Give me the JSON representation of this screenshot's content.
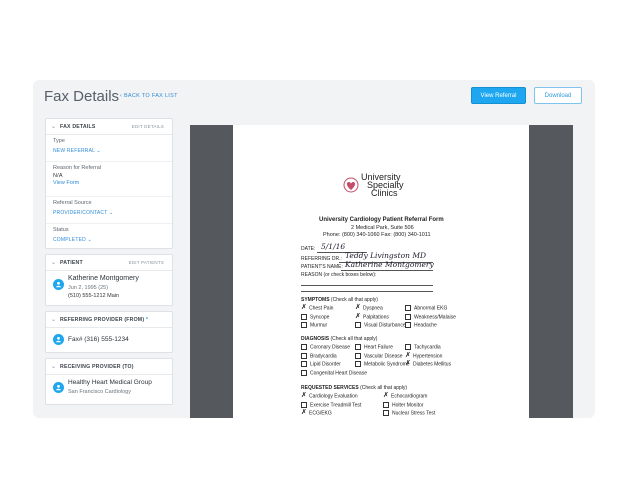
{
  "header": {
    "title": "Fax Details",
    "back_link": "‹ Back to fax list",
    "view_referral": "View Referral",
    "download": "Download"
  },
  "fax_details": {
    "heading": "FAX DETAILS",
    "action": "EDIT DETAILS",
    "type_label": "Type",
    "type_value": "NEW REFERRAL ⌄",
    "reason_label": "Reason for Referral",
    "reason_value": "N/A",
    "reason_link": "View Form",
    "source_label": "Referral Source",
    "source_value": "PROVIDER/CONTACT ⌄",
    "status_label": "Status",
    "status_value": "COMPLETED ⌄"
  },
  "patient": {
    "heading": "PATIENT",
    "action": "EDIT PATIENTS",
    "name": "Katherine Montgomery",
    "dob": "Jun 2, 1995 (25)",
    "phone": "(510) 555-1212 Main"
  },
  "referring_provider": {
    "heading": "REFERRING PROVIDER (FROM)",
    "required": "*",
    "fax": "Fax# (316) 555-1234"
  },
  "receiving_provider": {
    "heading": "RECEIVING PROVIDER (TO)",
    "name": "Healthy Heart Medical Group",
    "location": "San Francisco Cardiology"
  },
  "document": {
    "logo_line1": "University",
    "logo_line2": "Specialty",
    "logo_line3": "Clinics",
    "form_title": "University Cardiology Patient Referral Form",
    "address": "2 Medical Park, Suite 506",
    "contact": "Phone: (800) 340-1060 Fax: (800) 340-1011",
    "date_label": "DATE:",
    "date_value": "5/1/16",
    "referring_label": "REFERRING DR.:",
    "referring_value": "Teddy Livingston MD",
    "patient_label": "PATIENT'S NAME:",
    "patient_value": "Katherine Montgomery",
    "reason_label": "REASON (or check boxes below):",
    "symptoms_heading": "SYMPTOMS",
    "symptoms_note": "(Check all that apply)",
    "symptoms": [
      {
        "label": "Chest Pain",
        "checked": true
      },
      {
        "label": "Dyspnea",
        "checked": true
      },
      {
        "label": "Abnormal EKG",
        "checked": false
      },
      {
        "label": "Syncope",
        "checked": false
      },
      {
        "label": "Palpitations",
        "checked": true
      },
      {
        "label": "Weakness/Malaise",
        "checked": false
      },
      {
        "label": "Murmur",
        "checked": false
      },
      {
        "label": "Visual Disturbance",
        "checked": false
      },
      {
        "label": "Headache",
        "checked": false
      }
    ],
    "diagnosis_heading": "DIAGNOSIS",
    "diagnosis_note": "(Check all that apply)",
    "diagnosis": [
      {
        "label": "Coronary Disease",
        "checked": false
      },
      {
        "label": "Heart Failure",
        "checked": false
      },
      {
        "label": "Tachycardia",
        "checked": false
      },
      {
        "label": "Bradycardia",
        "checked": false
      },
      {
        "label": "Vascular Disease",
        "checked": false
      },
      {
        "label": "Hypertension",
        "checked": true
      },
      {
        "label": "Lipid Disorder",
        "checked": false
      },
      {
        "label": "Metabolic Syndrome",
        "checked": false
      },
      {
        "label": "Diabetes Mellitus",
        "checked": true
      },
      {
        "label": "Congenital Heart Disease",
        "checked": false
      }
    ],
    "services_heading": "REQUESTED SERVICES",
    "services_note": "(Check all that apply)",
    "services": [
      {
        "label": "Cardiology Evaluation",
        "checked": true
      },
      {
        "label": "Echocardiogram",
        "checked": true
      },
      {
        "label": "Exercise Treadmill Test",
        "checked": false
      },
      {
        "label": "Holter Monitor",
        "checked": false
      },
      {
        "label": "ECG/EKG",
        "checked": true
      },
      {
        "label": "Nuclear Stress Test",
        "checked": false
      }
    ]
  },
  "colors": {
    "accent": "#1ea7f0",
    "link": "#2e8bd8",
    "viewer_bg": "#55595d"
  }
}
